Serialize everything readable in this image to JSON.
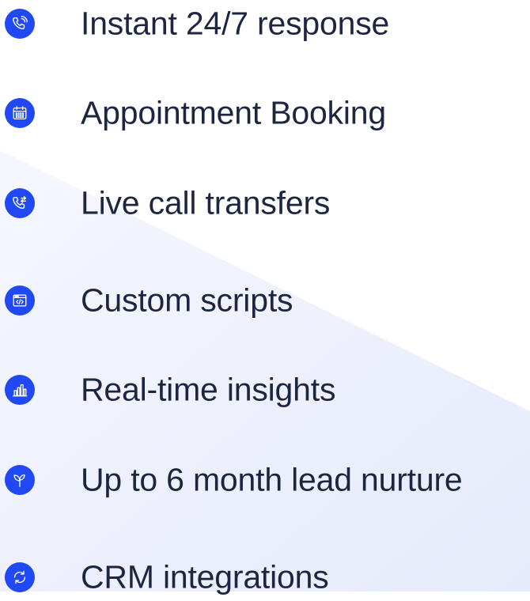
{
  "features": [
    {
      "label": "Instant 24/7 response",
      "icon": "phone-ringing-icon"
    },
    {
      "label": "Appointment Booking",
      "icon": "calendar-icon"
    },
    {
      "label": "Live call transfers",
      "icon": "phone-transfer-icon"
    },
    {
      "label": "Custom scripts",
      "icon": "code-window-icon"
    },
    {
      "label": "Real-time insights",
      "icon": "bar-chart-icon"
    },
    {
      "label": "Up to 6 month lead nurture",
      "icon": "sprout-icon"
    },
    {
      "label": "CRM integrations",
      "icon": "sync-icon"
    }
  ],
  "colors": {
    "accent": "#2149f3",
    "text": "#1d2640",
    "background": "#ffffff",
    "wedge": "#eef1fc"
  }
}
